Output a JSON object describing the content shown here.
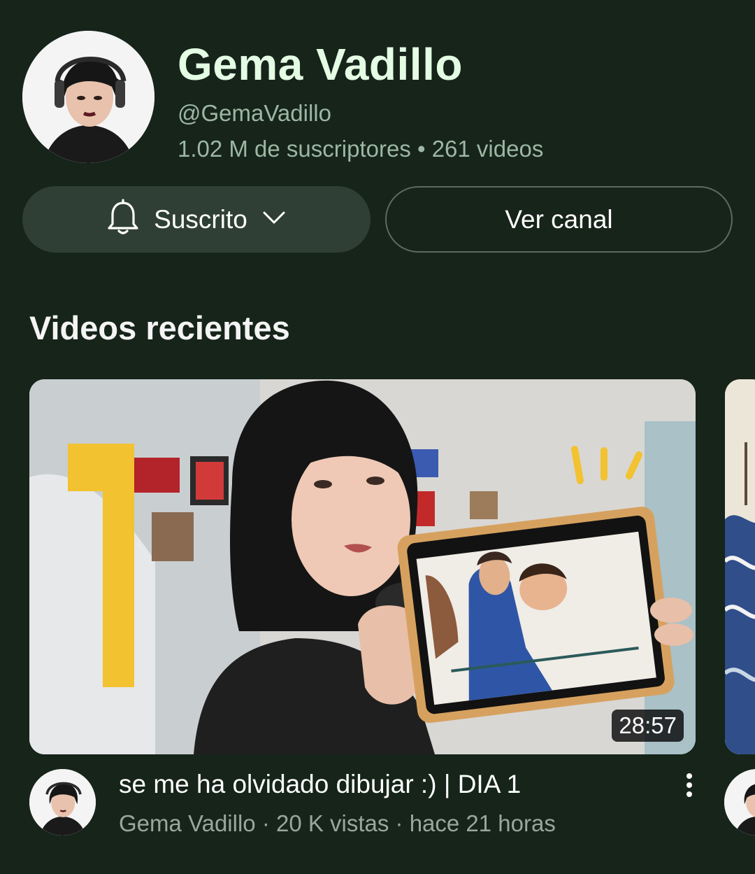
{
  "channel": {
    "name": "Gema Vadillo",
    "handle": "@GemaVadillo",
    "stats": "1.02 M de suscriptores • 261 videos",
    "avatar_icon": "user-avatar"
  },
  "actions": {
    "subscribed_label": "Suscrito",
    "bell_icon": "bell-icon",
    "dropdown_icon": "chevron-down-icon",
    "view_channel_label": "Ver canal"
  },
  "section": {
    "title": "Videos recientes"
  },
  "video": {
    "thumbnail_number": "1",
    "duration": "28:57",
    "title": "se me ha olvidado dibujar :) | DIA 1",
    "meta": "Gema Vadillo · 20 K vistas · hace 21 horas",
    "more_icon": "more-vertical-icon"
  },
  "colors": {
    "background": "#16241a",
    "name_text": "#e4fbe4",
    "secondary_text": "#9cb7a2",
    "subscribed_bg": "#2f3f35",
    "thumbnail_accent": "#f2c230"
  }
}
